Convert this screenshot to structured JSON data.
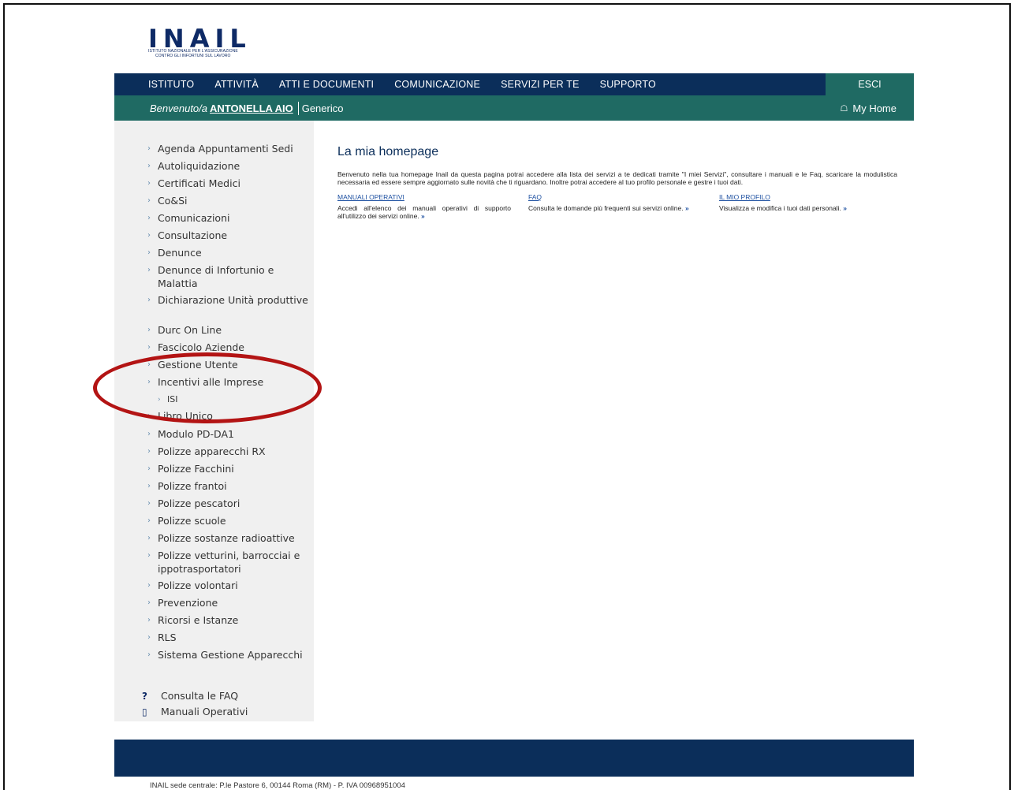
{
  "logo": {
    "wordmark": "INAIL",
    "line1": "ISTITUTO NAZIONALE PER L'ASSICURAZIONE",
    "line2": "CONTRO GLI INFORTUNI SUL LAVORO"
  },
  "topnav": {
    "items": [
      "ISTITUTO",
      "ATTIVITÀ",
      "ATTI E DOCUMENTI",
      "COMUNICAZIONE",
      "SERVIZI PER TE",
      "SUPPORTO"
    ],
    "logout": "ESCI"
  },
  "welcome": {
    "greeting": "Benvenuto/a",
    "user_name": "ANTONELLA AIO",
    "role": "Generico",
    "home_link": "My Home"
  },
  "sidebar": {
    "items": [
      "Agenda Appuntamenti Sedi",
      "Autoliquidazione",
      "Certificati Medici",
      "Co&Si",
      "Comunicazioni",
      "Consultazione",
      "Denunce",
      "Denunce di Infortunio e Malattia",
      "Dichiarazione Unità produttive",
      "Durc On Line",
      "Fascicolo Aziende",
      "Gestione Utente",
      "Incentivi alle Imprese",
      "ISI",
      "Libro Unico",
      "Modulo PD-DA1",
      "Polizze apparecchi RX",
      "Polizze Facchini",
      "Polizze frantoi",
      "Polizze pescatori",
      "Polizze scuole",
      "Polizze sostanze radioattive",
      "Polizze vetturini, barrocciai e ippotrasportatori",
      "Polizze volontari",
      "Prevenzione",
      "Ricorsi e Istanze",
      "RLS",
      "Sistema Gestione Apparecchi"
    ],
    "faq": "Consulta le FAQ",
    "manuals": "Manuali Operativi"
  },
  "main": {
    "title": "La mia homepage",
    "intro": "Benvenuto nella tua homepage Inail da questa pagina potrai accedere alla lista dei servizi a te dedicati tramite \"I miei Servizi\", consultare i manuali e le Faq, scaricare la modulistica necessaria ed essere sempre aggiornato sulle novità che ti riguardano. Inoltre potrai accedere al tuo profilo personale e gestre i tuoi dati.",
    "columns": [
      {
        "head": "MANUALI OPERATIVI",
        "body": "Accedi all'elenco dei manuali operativi di supporto all'utilizzo dei servizi online.",
        "more": "»"
      },
      {
        "head": "FAQ",
        "body": "Consulta le domande più frequenti sui servizi online.",
        "more": "»"
      },
      {
        "head": "IL MIO PROFILO",
        "body": "Visualizza e modifica i tuoi dati personali.",
        "more": "»"
      }
    ]
  },
  "footer": {
    "address": "INAIL sede centrale: P.le Pastore 6, 00144 Roma (RM) - P. IVA 00968951004"
  },
  "colors": {
    "navy": "#0b2e5a",
    "teal": "#1f6a63",
    "annotation_red": "#b31414",
    "link_blue": "#1c4fa0"
  }
}
